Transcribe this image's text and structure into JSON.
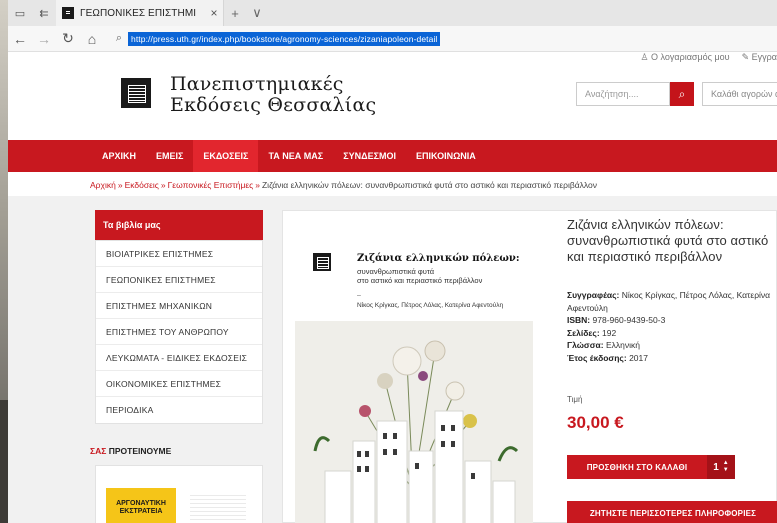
{
  "browser": {
    "tab_title": "ΓΕΩΠΟΝΙΚΕΣ ΕΠΙΣΤΗΜΙ",
    "tab_close": "×",
    "new_tab": "+",
    "tab_menu": "∨",
    "url": "http://press.uth.gr/index.php/bookstore/agronomy-sciences/zizaniapoleon-detail"
  },
  "header": {
    "account_link": "Ο λογαριασμός μου",
    "register_link": "Εγγρα",
    "logo_line1": "Πανεπιστημιακές",
    "logo_line2": "Εκδόσεις Θεσσαλίας",
    "search_placeholder": "Αναζήτηση....",
    "cart_label": "Καλάθι αγορών άδ"
  },
  "menu": {
    "items": [
      "ΑΡΧΙΚΗ",
      "ΕΜΕΙΣ",
      "ΕΚΔΟΣΕΙΣ",
      "ΤΑ ΝΕΑ ΜΑΣ",
      "ΣΥΝΔΕΣΜΟΙ",
      "ΕΠΙΚΟΙΝΩΝΙΑ"
    ],
    "active_index": 2
  },
  "breadcrumb": {
    "home": "Αρχική",
    "publications": "Εκδόσεις",
    "category": "Γεωπονικές Επιστήμες",
    "current": "Ζιζάνια ελληνικών πόλεων: συνανθρωπιστικά φυτά στο αστικό και περιαστικό περιβάλλον",
    "separator": "»"
  },
  "sidebar": {
    "title": "Τα βιβλία μας",
    "items": [
      "ΒΙΟΙΑΤΡΙΚΕΣ ΕΠΙΣΤΗΜΕΣ",
      "ΓΕΩΠΟΝΙΚΕΣ ΕΠΙΣΤΗΜΕΣ",
      "ΕΠΙΣΤΗΜΕΣ ΜΗΧΑΝΙΚΩΝ",
      "ΕΠΙΣΤΗΜΕΣ ΤΟΥ ΑΝΘΡΩΠΟΥ",
      "ΛΕΥΚΩΜΑΤΑ - ΕΙΔΙΚΕΣ ΕΚΔΟΣΕΙΣ",
      "ΟΙΚΟΝΟΜΙΚΕΣ ΕΠΙΣΤΗΜΕΣ",
      "ΠΕΡΙΟΔΙΚΑ"
    ],
    "suggest_highlight": "ΣΑΣ",
    "suggest_rest": "ΠΡΟΤΕΙΝΟΥΜΕ",
    "suggest_cover_text": "ΑΡΓΟΝΑΥΤΙΚΗ ΕΚΣΤΡΑΤΕΙΑ"
  },
  "cover": {
    "title": "Ζιζάνια ελληνικών πόλεων:",
    "subtitle_line1": "συνανθρωπιστικά φυτά",
    "subtitle_line2": "στο αστικό και περιαστικό περιβάλλον",
    "dash": "–",
    "authors": "Νίκος Κρίγκας, Πέτρος Λόλας, Κατερίνα Αφεντούλη"
  },
  "product": {
    "title": "Ζιζάνια ελληνικών πόλεων: συνανθρωπιστικά φυτά στο αστικό και περιαστικό περιβάλλον",
    "authors_label": "Συγγραφέας:",
    "authors": "Νίκος Κρίγκας, Πέτρος Λόλας, Κατερίνα Αφεντούλη",
    "isbn_label": "ISBN:",
    "isbn": "978-960-9439-50-3",
    "pages_label": "Σελίδες:",
    "pages": "192",
    "language_label": "Γλώσσα:",
    "language": "Ελληνική",
    "year_label": "Έτος έκδοσης:",
    "year": "2017",
    "price_label": "Τιμή",
    "price": "30,00 €",
    "add_to_cart": "ΠΡΟΣΘΗΚΗ ΣΤΟ ΚΑΛΑΘΙ",
    "quantity": "1",
    "more_info": "ΖΗΤΗΣΤΕ ΠΕΡΙΣΣΟΤΕΡΕΣ ΠΛΗΡΟΦΟΡΙΕΣ"
  },
  "colors": {
    "brand_red": "#c8181f",
    "url_highlight": "#0a64d6"
  }
}
